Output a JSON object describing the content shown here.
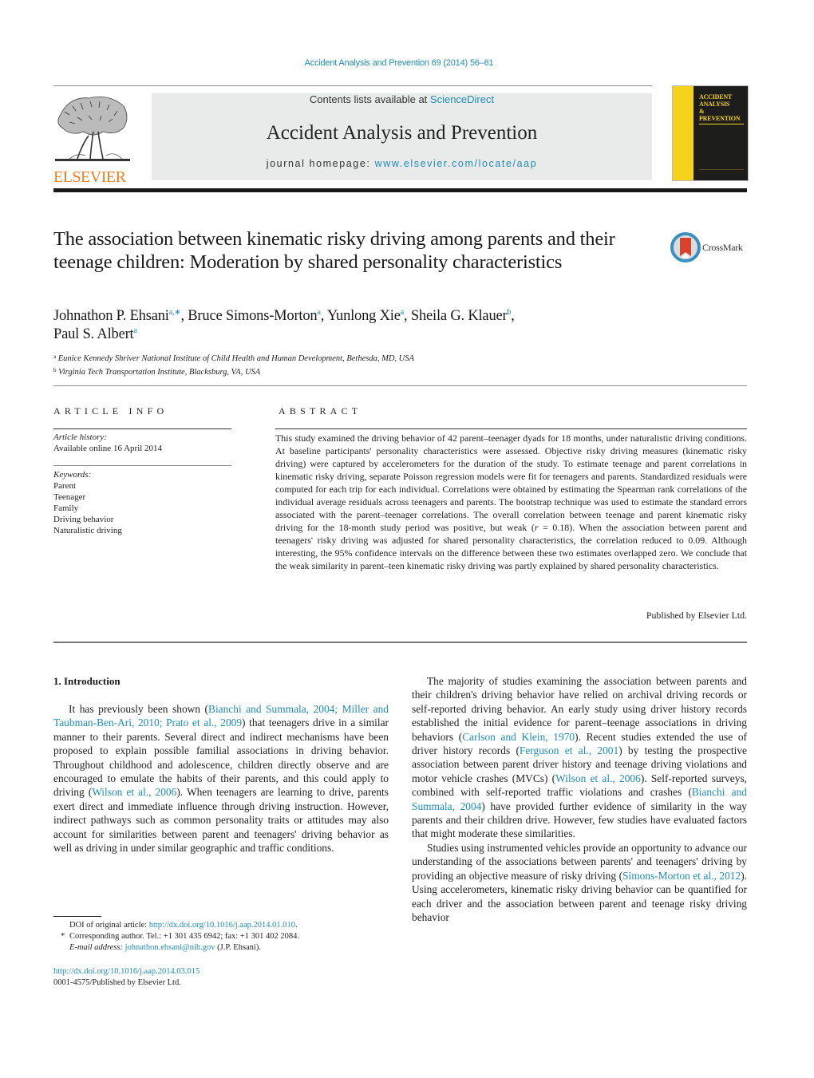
{
  "running_head": {
    "journal_citation": "Accident Analysis and Prevention 69 (2014) 56–61"
  },
  "masthead": {
    "publisher_logo_text": "ELSEVIER",
    "contents_prefix": "Contents lists available at ",
    "contents_link": "ScienceDirect",
    "journal_name": "Accident Analysis and Prevention",
    "homepage_prefix": "journal homepage: ",
    "homepage_link": "www.elsevier.com/locate/aap",
    "cover_title_lines": [
      "ACCIDENT",
      "ANALYSIS",
      "&",
      "PREVENTION"
    ],
    "colors": {
      "link": "#1f8cb8",
      "elsevier_orange": "#f07f1e",
      "cover_yellow": "#f6d21a",
      "cover_black": "#1d1d1b",
      "masthead_bg": "#e9eaea"
    }
  },
  "article": {
    "title": "The association between kinematic risky driving among parents and their teenage children: Moderation by shared personality characteristics",
    "crossmark_label": "CrossMark",
    "authors": [
      {
        "name": "Johnathon P. Ehsani",
        "affil": "a,∗",
        "sep": ", "
      },
      {
        "name": "Bruce Simons-Morton",
        "affil": "a",
        "sep": ", "
      },
      {
        "name": "Yunlong Xie",
        "affil": "a",
        "sep": ", "
      },
      {
        "name": "Sheila G. Klauer",
        "affil": "b",
        "sep": ","
      },
      {
        "name": "Paul S. Albert",
        "affil": "a",
        "sep": ""
      }
    ],
    "affiliations": [
      {
        "mark": "a",
        "text": "Eunice Kennedy Shriver National Institute of Child Health and Human Development, Bethesda, MD, USA"
      },
      {
        "mark": "b",
        "text": "Virginia Tech Transportation Institute, Blacksburg, VA, USA"
      }
    ]
  },
  "article_info": {
    "heading": "ARTICLE INFO",
    "history_label": "Article history:",
    "history_value": "Available online 16 April 2014",
    "keywords_label": "Keywords:",
    "keywords": [
      "Parent",
      "Teenager",
      "Family",
      "Driving behavior",
      "Naturalistic driving"
    ]
  },
  "abstract": {
    "heading": "ABSTRACT",
    "text_before_r": "This study examined the driving behavior of 42 parent–teenager dyads for 18 months, under naturalistic driving conditions. At baseline participants' personality characteristics were assessed. Objective risky driving measures (kinematic risky driving) were captured by accelerometers for the duration of the study. To estimate teenage and parent correlations in kinematic risky driving, separate Poisson regression models were fit for teenagers and parents. Standardized residuals were computed for each trip for each individual. Correlations were obtained by estimating the Spearman rank correlations of the individual average residuals across teenagers and parents. The bootstrap technique was used to estimate the standard errors associated with the parent–teenager correlations. The overall correlation between teenage and parent kinematic risky driving for the 18-month study period was positive, but weak (",
    "r_symbol": "r",
    "text_after_r": " = 0.18). When the association between parent and teenagers' risky driving was adjusted for shared personality characteristics, the correlation reduced to 0.09. Although interesting, the 95% confidence intervals on the difference between these two estimates overlapped zero. We conclude that the weak similarity in parent–teen kinematic risky driving was partly explained by shared personality characteristics.",
    "published_by": "Published by Elsevier Ltd."
  },
  "introduction": {
    "heading": "1.  Introduction",
    "left_col": {
      "p1_part1": "It has previously been shown (",
      "p1_cite1": "Bianchi and Summala, 2004; Miller and Taubman-Ben-Ari, 2010; Prato et al., 2009",
      "p1_part2": ") that teenagers drive in a similar manner to their parents. Several direct and indirect mechanisms have been proposed to explain possible familial associations in driving behavior. Throughout childhood and adolescence, children directly observe and are encouraged to emulate the habits of their parents, and this could apply to driving (",
      "p1_cite2": "Wilson et al., 2006",
      "p1_part3": "). When teenagers are learning to drive, parents exert direct and immediate influence through driving instruction. However, indirect pathways such as common personality traits or attitudes may also account for similarities between parent and teenagers' driving behavior as well as driving in under similar geographic and traffic conditions."
    },
    "right_col": {
      "p2_part1": "The majority of studies examining the association between parents and their children's driving behavior have relied on archival driving records or self-reported driving behavior. An early study using driver history records established the initial evidence for parent–teenage associations in driving behaviors (",
      "p2_cite1": "Carlson and Klein, 1970",
      "p2_part2": "). Recent studies extended the use of driver history records (",
      "p2_cite2": "Ferguson et al., 2001",
      "p2_part3": ") by testing the prospective association between parent driver history and teenage driving violations and motor vehicle crashes (MVCs) (",
      "p2_cite3": "Wilson et al., 2006",
      "p2_part4": "). Self-reported surveys, combined with self-reported traffic violations and crashes (",
      "p2_cite4": "Bianchi and Summala, 2004",
      "p2_part5": ") have provided further evidence of similarity in the way parents and their children drive. However, few studies have evaluated factors that might moderate these similarities.",
      "p3_part1": "Studies using instrumented vehicles provide an opportunity to advance our understanding of the associations between parents' and teenagers' driving by providing an objective measure of risky driving (",
      "p3_cite1": "Simons-Morton et al., 2012",
      "p3_part2": "). Using accelerometers, kinematic risky driving behavior can be quantified for each driver and the association between parent and teenage risky driving behavior"
    }
  },
  "footnotes": {
    "doi_original_label": "DOI of original article: ",
    "doi_original_link": "http://dx.doi.org/10.1016/j.aap.2014.01.010",
    "doi_original_end": ".",
    "corresponding_mark": "*",
    "corresponding_text": "Corresponding author. Tel.: +1 301 435 6942; fax: +1 301 402 2084.",
    "email_label": "E-mail address: ",
    "email_link": "johnathon.ehsani@nih.gov",
    "email_suffix": " (J.P. Ehsani)."
  },
  "doi_block": {
    "doi_link": "http://dx.doi.org/10.1016/j.aap.2014.03.015",
    "issn_line": "0001-4575/Published by Elsevier Ltd."
  }
}
